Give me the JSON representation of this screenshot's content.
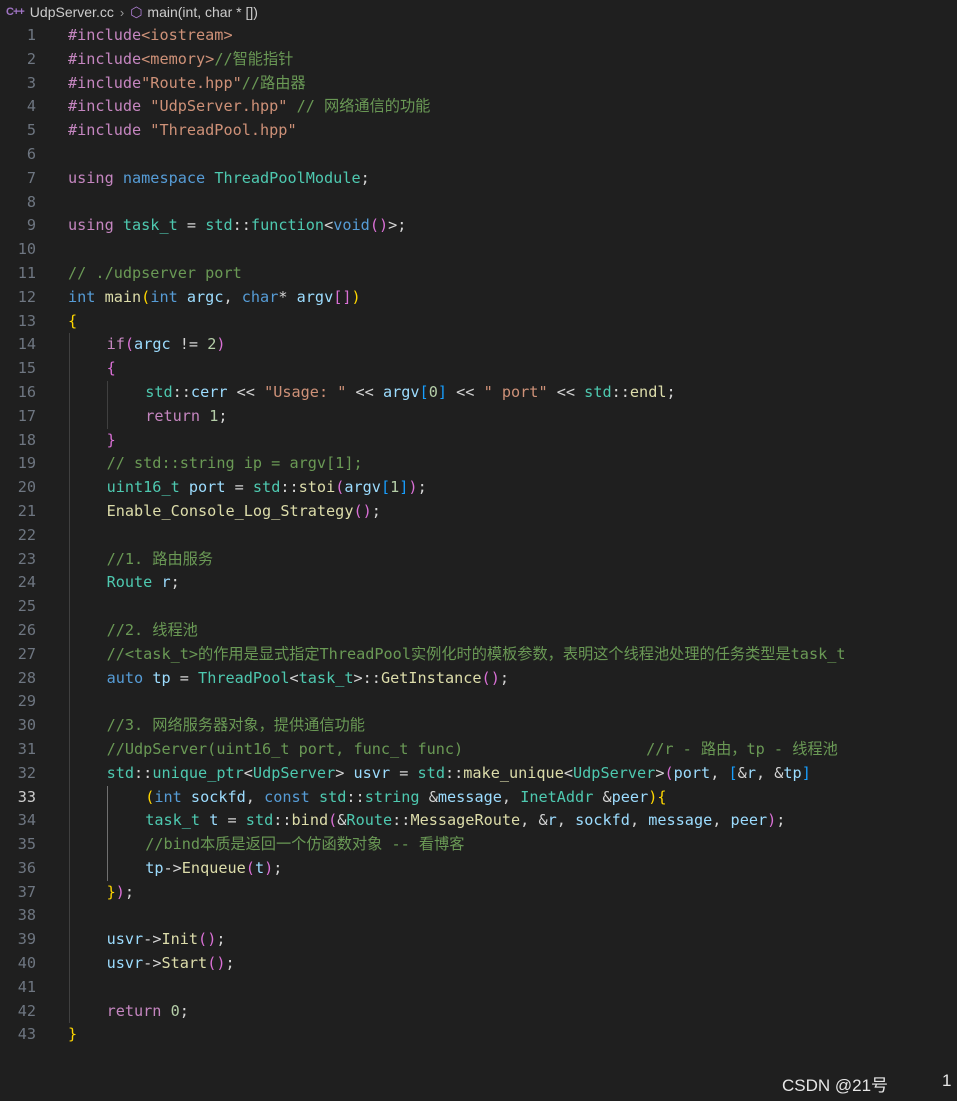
{
  "breadcrumb": {
    "file_icon": "C++",
    "file_name": "UdpServer.cc",
    "separator": "›",
    "symbol_icon": "⬡",
    "symbol_name": "main(int, char * [])"
  },
  "editor": {
    "active_line": 33,
    "lines": [
      {
        "n": "1",
        "indent": 0,
        "tokens": [
          [
            "ctl",
            "#include"
          ],
          [
            "str",
            "<iostream>"
          ]
        ]
      },
      {
        "n": "2",
        "indent": 0,
        "tokens": [
          [
            "ctl",
            "#include"
          ],
          [
            "str",
            "<memory>"
          ],
          [
            "cm",
            "//智能指针"
          ]
        ]
      },
      {
        "n": "3",
        "indent": 0,
        "tokens": [
          [
            "ctl",
            "#include"
          ],
          [
            "str",
            "\"Route.hpp\""
          ],
          [
            "cm",
            "//路由器"
          ]
        ]
      },
      {
        "n": "4",
        "indent": 0,
        "tokens": [
          [
            "ctl",
            "#include "
          ],
          [
            "str",
            "\"UdpServer.hpp\""
          ],
          [
            "cm",
            " // 网络通信的功能"
          ]
        ]
      },
      {
        "n": "5",
        "indent": 0,
        "tokens": [
          [
            "ctl",
            "#include "
          ],
          [
            "str",
            "\"ThreadPool.hpp\""
          ]
        ]
      },
      {
        "n": "6",
        "indent": 0,
        "tokens": []
      },
      {
        "n": "7",
        "indent": 0,
        "tokens": [
          [
            "ctl",
            "using "
          ],
          [
            "kw",
            "namespace "
          ],
          [
            "ty",
            "ThreadPoolModule"
          ],
          [
            "op",
            ";"
          ]
        ]
      },
      {
        "n": "8",
        "indent": 0,
        "tokens": []
      },
      {
        "n": "9",
        "indent": 0,
        "tokens": [
          [
            "ctl",
            "using "
          ],
          [
            "ty",
            "task_t"
          ],
          [
            "op",
            " = "
          ],
          [
            "ty",
            "std"
          ],
          [
            "op",
            "::"
          ],
          [
            "ty",
            "function"
          ],
          [
            "op",
            "<"
          ],
          [
            "kw",
            "void"
          ],
          [
            "b2",
            "()"
          ],
          [
            "op",
            ">;"
          ]
        ]
      },
      {
        "n": "10",
        "indent": 0,
        "tokens": []
      },
      {
        "n": "11",
        "indent": 0,
        "tokens": [
          [
            "cm",
            "// ./udpserver port"
          ]
        ]
      },
      {
        "n": "12",
        "indent": 0,
        "tokens": [
          [
            "kw",
            "int "
          ],
          [
            "fn",
            "main"
          ],
          [
            "b1",
            "("
          ],
          [
            "kw",
            "int "
          ],
          [
            "var",
            "argc"
          ],
          [
            "op",
            ", "
          ],
          [
            "kw",
            "char"
          ],
          [
            "op",
            "* "
          ],
          [
            "var",
            "argv"
          ],
          [
            "b2",
            "[]"
          ],
          [
            "b1",
            ")"
          ]
        ]
      },
      {
        "n": "13",
        "indent": 0,
        "tokens": [
          [
            "b1",
            "{"
          ]
        ]
      },
      {
        "n": "14",
        "indent": 1,
        "tokens": [
          [
            "ctl",
            "if"
          ],
          [
            "b2",
            "("
          ],
          [
            "var",
            "argc"
          ],
          [
            "op",
            " != "
          ],
          [
            "num",
            "2"
          ],
          [
            "b2",
            ")"
          ]
        ]
      },
      {
        "n": "15",
        "indent": 1,
        "tokens": [
          [
            "b2",
            "{"
          ]
        ]
      },
      {
        "n": "16",
        "indent": 2,
        "tokens": [
          [
            "ty",
            "std"
          ],
          [
            "op",
            "::"
          ],
          [
            "var",
            "cerr"
          ],
          [
            "op",
            " << "
          ],
          [
            "str",
            "\"Usage: \""
          ],
          [
            "op",
            " << "
          ],
          [
            "var",
            "argv"
          ],
          [
            "b3",
            "["
          ],
          [
            "num",
            "0"
          ],
          [
            "b3",
            "]"
          ],
          [
            "op",
            " << "
          ],
          [
            "str",
            "\" port\""
          ],
          [
            "op",
            " << "
          ],
          [
            "ty",
            "std"
          ],
          [
            "op",
            "::"
          ],
          [
            "fn",
            "endl"
          ],
          [
            "op",
            ";"
          ]
        ]
      },
      {
        "n": "17",
        "indent": 2,
        "tokens": [
          [
            "ctl",
            "return "
          ],
          [
            "num",
            "1"
          ],
          [
            "op",
            ";"
          ]
        ]
      },
      {
        "n": "18",
        "indent": 1,
        "tokens": [
          [
            "b2",
            "}"
          ]
        ]
      },
      {
        "n": "19",
        "indent": 1,
        "tokens": [
          [
            "cm",
            "// std::string ip = argv[1];"
          ]
        ]
      },
      {
        "n": "20",
        "indent": 1,
        "tokens": [
          [
            "ty",
            "uint16_t "
          ],
          [
            "var",
            "port"
          ],
          [
            "op",
            " = "
          ],
          [
            "ty",
            "std"
          ],
          [
            "op",
            "::"
          ],
          [
            "fn",
            "stoi"
          ],
          [
            "b2",
            "("
          ],
          [
            "var",
            "argv"
          ],
          [
            "b3",
            "["
          ],
          [
            "num",
            "1"
          ],
          [
            "b3",
            "]"
          ],
          [
            "b2",
            ")"
          ],
          [
            "op",
            ";"
          ]
        ]
      },
      {
        "n": "21",
        "indent": 1,
        "tokens": [
          [
            "fn",
            "Enable_Console_Log_Strategy"
          ],
          [
            "b2",
            "()"
          ],
          [
            "op",
            ";"
          ]
        ]
      },
      {
        "n": "22",
        "indent": 1,
        "tokens": []
      },
      {
        "n": "23",
        "indent": 1,
        "tokens": [
          [
            "cm",
            "//1. 路由服务"
          ]
        ]
      },
      {
        "n": "24",
        "indent": 1,
        "tokens": [
          [
            "ty",
            "Route "
          ],
          [
            "var",
            "r"
          ],
          [
            "op",
            ";"
          ]
        ]
      },
      {
        "n": "25",
        "indent": 1,
        "tokens": []
      },
      {
        "n": "26",
        "indent": 1,
        "tokens": [
          [
            "cm",
            "//2. 线程池"
          ]
        ]
      },
      {
        "n": "27",
        "indent": 1,
        "tokens": [
          [
            "cm",
            "//<task_t>的作用是显式指定ThreadPool实例化时的模板参数，表明这个线程池处理的任务类型是task_t"
          ]
        ]
      },
      {
        "n": "28",
        "indent": 1,
        "tokens": [
          [
            "kw",
            "auto "
          ],
          [
            "var",
            "tp"
          ],
          [
            "op",
            " = "
          ],
          [
            "ty",
            "ThreadPool"
          ],
          [
            "op",
            "<"
          ],
          [
            "ty",
            "task_t"
          ],
          [
            "op",
            ">::"
          ],
          [
            "fn",
            "GetInstance"
          ],
          [
            "b2",
            "()"
          ],
          [
            "op",
            ";"
          ]
        ]
      },
      {
        "n": "29",
        "indent": 1,
        "tokens": []
      },
      {
        "n": "30",
        "indent": 1,
        "tokens": [
          [
            "cm",
            "//3. 网络服务器对象，提供通信功能"
          ]
        ]
      },
      {
        "n": "31",
        "indent": 1,
        "tokens": [
          [
            "cm",
            "//UdpServer(uint16_t port, func_t func)                    //r - 路由，tp - 线程池"
          ]
        ]
      },
      {
        "n": "32",
        "indent": 1,
        "tokens": [
          [
            "ty",
            "std"
          ],
          [
            "op",
            "::"
          ],
          [
            "ty",
            "unique_ptr"
          ],
          [
            "op",
            "<"
          ],
          [
            "ty",
            "UdpServer"
          ],
          [
            "op",
            "> "
          ],
          [
            "var",
            "usvr"
          ],
          [
            "op",
            " = "
          ],
          [
            "ty",
            "std"
          ],
          [
            "op",
            "::"
          ],
          [
            "fn",
            "make_unique"
          ],
          [
            "op",
            "<"
          ],
          [
            "ty",
            "UdpServer"
          ],
          [
            "op",
            ">"
          ],
          [
            "b2",
            "("
          ],
          [
            "var",
            "port"
          ],
          [
            "op",
            ", "
          ],
          [
            "b3",
            "["
          ],
          [
            "op",
            "&"
          ],
          [
            "var",
            "r"
          ],
          [
            "op",
            ", &"
          ],
          [
            "var",
            "tp"
          ],
          [
            "b3",
            "]"
          ]
        ]
      },
      {
        "n": "33",
        "indent": 2,
        "tokens": [
          [
            "b1",
            "("
          ],
          [
            "kw",
            "int "
          ],
          [
            "var",
            "sockfd"
          ],
          [
            "op",
            ", "
          ],
          [
            "kw",
            "const "
          ],
          [
            "ty",
            "std"
          ],
          [
            "op",
            "::"
          ],
          [
            "ty",
            "string "
          ],
          [
            "op",
            "&"
          ],
          [
            "var",
            "message"
          ],
          [
            "op",
            ", "
          ],
          [
            "ty",
            "InetAddr "
          ],
          [
            "op",
            "&"
          ],
          [
            "var",
            "peer"
          ],
          [
            "b1",
            ")"
          ],
          [
            "b1",
            "{"
          ]
        ]
      },
      {
        "n": "34",
        "indent": 2,
        "tokens": [
          [
            "ty",
            "task_t "
          ],
          [
            "var",
            "t"
          ],
          [
            "op",
            " = "
          ],
          [
            "ty",
            "std"
          ],
          [
            "op",
            "::"
          ],
          [
            "fn",
            "bind"
          ],
          [
            "b2",
            "("
          ],
          [
            "op",
            "&"
          ],
          [
            "ty",
            "Route"
          ],
          [
            "op",
            "::"
          ],
          [
            "fn",
            "MessageRoute"
          ],
          [
            "op",
            ", &"
          ],
          [
            "var",
            "r"
          ],
          [
            "op",
            ", "
          ],
          [
            "var",
            "sockfd"
          ],
          [
            "op",
            ", "
          ],
          [
            "var",
            "message"
          ],
          [
            "op",
            ", "
          ],
          [
            "var",
            "peer"
          ],
          [
            "b2",
            ")"
          ],
          [
            "op",
            ";"
          ]
        ]
      },
      {
        "n": "35",
        "indent": 2,
        "tokens": [
          [
            "cm",
            "//bind本质是返回一个仿函数对象 -- 看博客"
          ]
        ]
      },
      {
        "n": "36",
        "indent": 2,
        "tokens": [
          [
            "var",
            "tp"
          ],
          [
            "op",
            "->"
          ],
          [
            "fn",
            "Enqueue"
          ],
          [
            "b2",
            "("
          ],
          [
            "var",
            "t"
          ],
          [
            "b2",
            ")"
          ],
          [
            "op",
            ";"
          ]
        ]
      },
      {
        "n": "37",
        "indent": 1,
        "tokens": [
          [
            "b1",
            "}"
          ],
          [
            "b2",
            ")"
          ],
          [
            "op",
            ";"
          ]
        ]
      },
      {
        "n": "38",
        "indent": 1,
        "tokens": []
      },
      {
        "n": "39",
        "indent": 1,
        "tokens": [
          [
            "var",
            "usvr"
          ],
          [
            "op",
            "->"
          ],
          [
            "fn",
            "Init"
          ],
          [
            "b2",
            "()"
          ],
          [
            "op",
            ";"
          ]
        ]
      },
      {
        "n": "40",
        "indent": 1,
        "tokens": [
          [
            "var",
            "usvr"
          ],
          [
            "op",
            "->"
          ],
          [
            "fn",
            "Start"
          ],
          [
            "b2",
            "()"
          ],
          [
            "op",
            ";"
          ]
        ]
      },
      {
        "n": "41",
        "indent": 1,
        "tokens": []
      },
      {
        "n": "42",
        "indent": 1,
        "tokens": [
          [
            "ctl",
            "return "
          ],
          [
            "num",
            "0"
          ],
          [
            "op",
            ";"
          ]
        ]
      },
      {
        "n": "43",
        "indent": 0,
        "tokens": [
          [
            "b1",
            "}"
          ]
        ]
      }
    ]
  },
  "watermark": "CSDN @21号",
  "edge_number": "1"
}
